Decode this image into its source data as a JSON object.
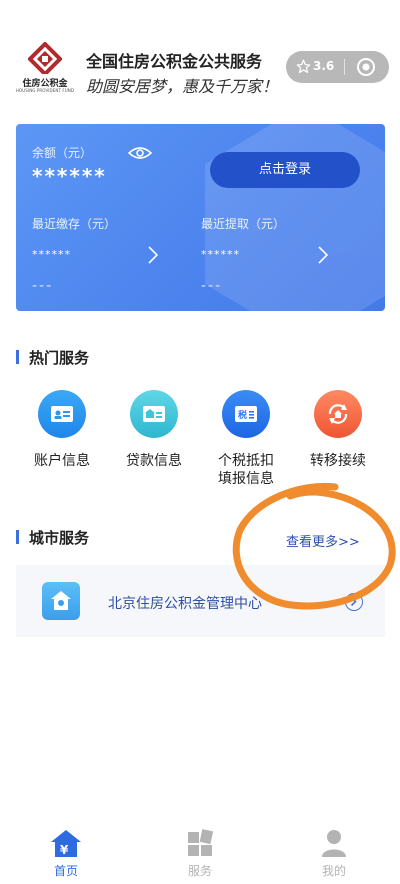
{
  "header": {
    "logo_name": "住房公积金",
    "logo_sub": "HOUSING PROVIDENT FUND",
    "title": "全国住房公积金公共服务",
    "slogan": "助圆安居梦，惠及千万家！",
    "rating": "3.6",
    "icons": {
      "rating": "star-icon",
      "menu": "target-icon"
    }
  },
  "account_card": {
    "balance_label": "余额（元）",
    "balance_value": "******",
    "login_label": "点击登录",
    "deposit_label": "最近缴存（元）",
    "deposit_value": "******",
    "deposit_date": "---",
    "withdraw_label": "最近提取（元）",
    "withdraw_value": "******",
    "withdraw_date": "---"
  },
  "hot_services": {
    "title": "热门服务",
    "items": [
      {
        "label": "账户信息",
        "icon": "account-card-icon",
        "color": "#2b97f0"
      },
      {
        "label": "贷款信息",
        "icon": "loan-house-icon",
        "color": "#3cc6d8"
      },
      {
        "label": "个税抵扣填报信息",
        "label_line1": "个税抵扣",
        "label_line2": "填报信息",
        "icon": "tax-icon",
        "color": "#2e78ee"
      },
      {
        "label": "转移接续",
        "icon": "transfer-house-icon",
        "color": "#f56a45"
      }
    ]
  },
  "city_services": {
    "title": "城市服务",
    "more_label": "查看更多>>",
    "items": [
      {
        "name": "北京住房公积金管理中心",
        "icon": "city-house-icon"
      }
    ]
  },
  "tabbar": {
    "items": [
      {
        "label": "首页",
        "icon": "home-icon",
        "active": true
      },
      {
        "label": "服务",
        "icon": "services-icon",
        "active": false
      },
      {
        "label": "我的",
        "icon": "profile-icon",
        "active": false
      }
    ]
  },
  "colors": {
    "primary": "#3d6fe3",
    "login_button": "#2351c9",
    "tab_active": "#2f6be0",
    "tab_inactive": "#b3b3b3",
    "scribble": "#f08b2e"
  }
}
